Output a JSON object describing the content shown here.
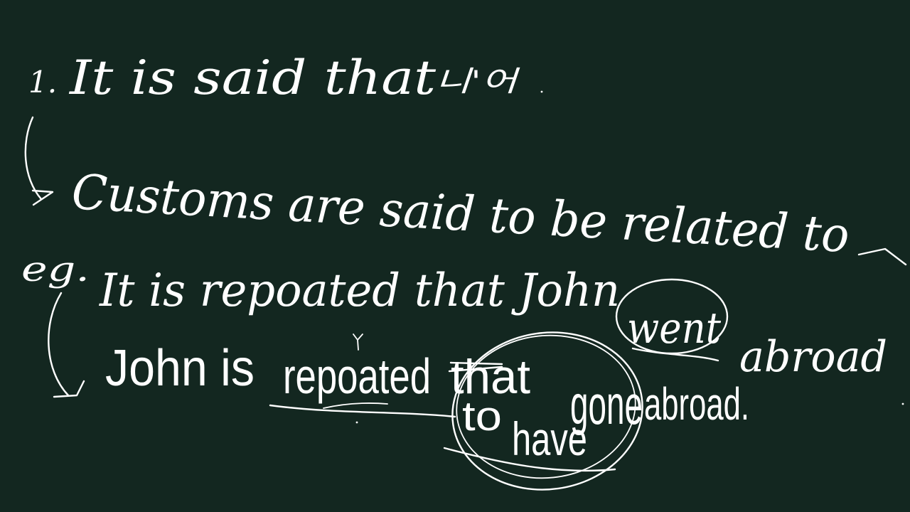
{
  "board": {
    "background": "#132720",
    "ink": "#ffffff"
  },
  "lines": {
    "line1_num": "1.",
    "line1_text": "It is said that",
    "line1_korean": "니'어",
    "line2_text": "Customs are said to be related to",
    "line3_eg": "eg.",
    "line3_text": "It is repoated that John",
    "line3_went": "went",
    "line3_abroad": "abroad",
    "line4_text": "John is",
    "line4_reported": "repoated",
    "line4_that": "that",
    "line4_to": "to",
    "line4_have": "have",
    "line4_gone": "gone",
    "line4_abroad": "abroad."
  }
}
